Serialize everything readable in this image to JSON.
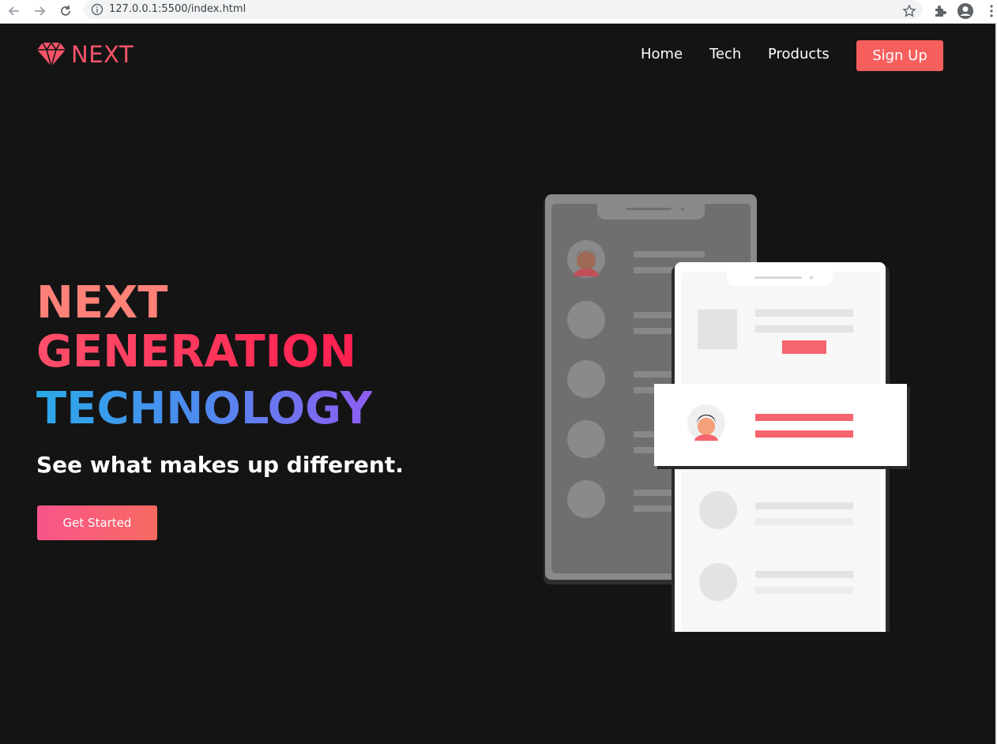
{
  "browser": {
    "url": "127.0.0.1:5500/index.html",
    "icons": [
      "back-arrow-icon",
      "forward-arrow-icon",
      "reload-icon",
      "info-icon",
      "star-icon",
      "extensions-icon",
      "profile-icon",
      "menu-dots-icon"
    ]
  },
  "brand": {
    "name": "NEXT",
    "icon": "diamond-icon",
    "accent_color": "#f6546a"
  },
  "nav": {
    "links": [
      "Home",
      "Tech",
      "Products"
    ],
    "signup_label": "Sign Up",
    "signup_color": "#f65f5c"
  },
  "hero": {
    "line1": "NEXT",
    "line2": "GENERATION",
    "line3": "TECHNOLOGY",
    "subtitle": "See what makes up different.",
    "cta_label": "Get Started"
  },
  "colors": {
    "background": "#141414",
    "line1": "#ff8177",
    "line2_gradient": [
      "#ff4f6a",
      "#ff1f4f"
    ],
    "line3_gradient": [
      "#2aa9e8",
      "#8f5cf0"
    ],
    "cta_gradient": [
      "#f8558a",
      "#f86a62"
    ]
  },
  "illustration": {
    "icon": "phones-illustration"
  }
}
